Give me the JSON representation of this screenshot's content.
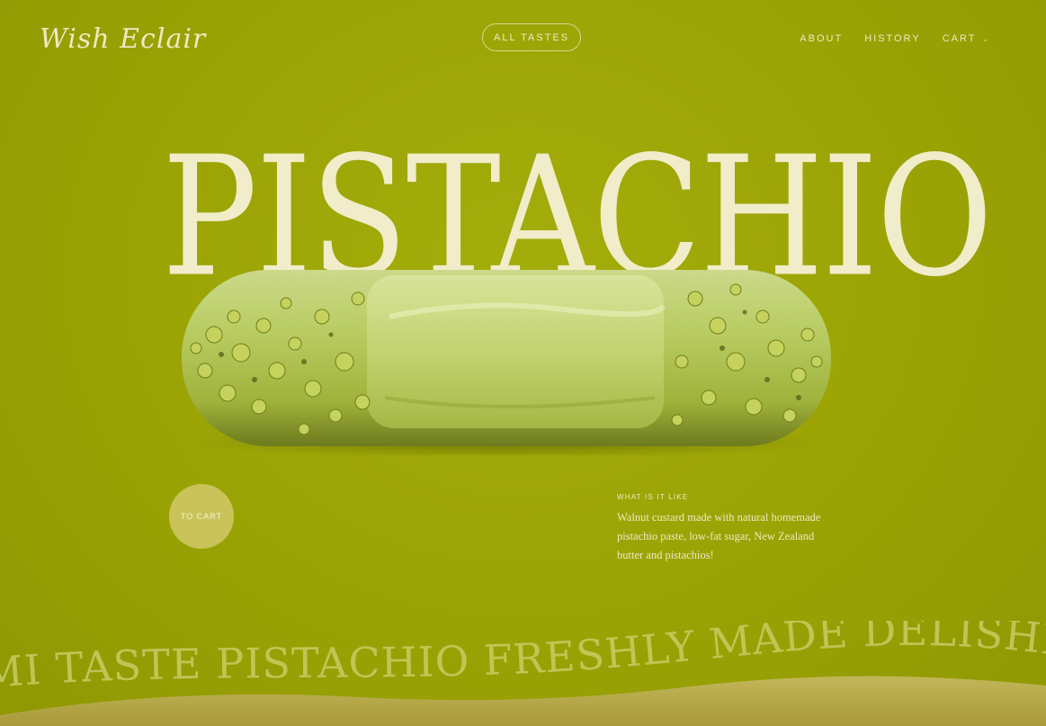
{
  "header": {
    "logo": "Wish Eclair",
    "center_button": "ALL TASTES",
    "nav": [
      {
        "label": "ABOUT"
      },
      {
        "label": "HISTORY"
      },
      {
        "label": "CART"
      }
    ]
  },
  "hero": {
    "title": "PISTACHIO",
    "to_cart_label": "TO CART"
  },
  "info": {
    "label": "WHAT IS IT LIKE",
    "description": "Walnut custard made with natural homemade pistachio paste, low-fat sugar, New Zealand butter and pistachios!"
  },
  "marquee": {
    "text": "MI TASTE PISTACHIO FRESHLY MADE DELISHIOUS"
  },
  "colors": {
    "background": "#9ba504",
    "text": "#f1ecc9",
    "button_fill": "#c9c35a",
    "wave": "#b8a84a"
  }
}
